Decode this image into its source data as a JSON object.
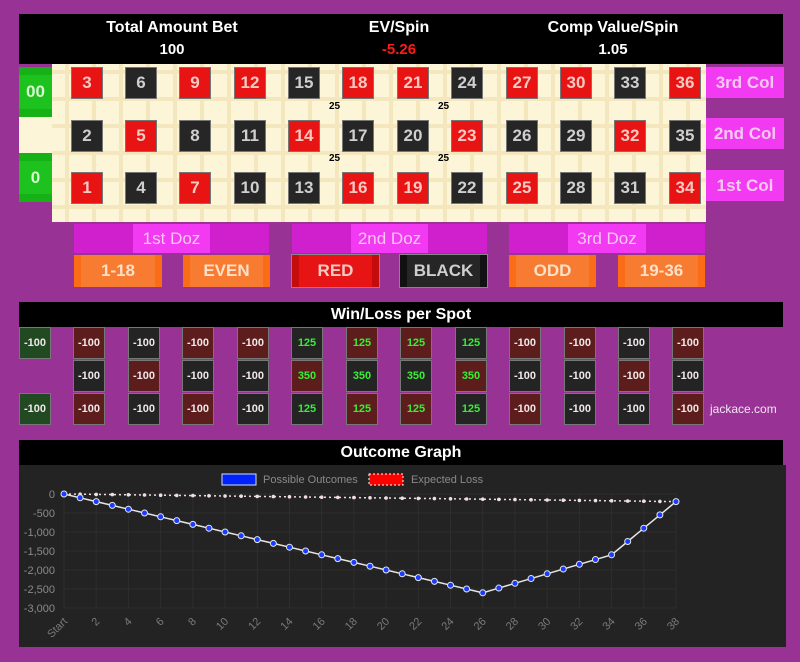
{
  "header": {
    "total_bet_label": "Total Amount Bet",
    "total_bet_value": "100",
    "ev_label": "EV/Spin",
    "ev_value": "-5.26",
    "comp_label": "Comp Value/Spin",
    "comp_value": "1.05"
  },
  "colors": {
    "ev_value": "#ff1a1a",
    "win": "#35f035",
    "background": "#983294"
  },
  "table": {
    "zero_top": "00",
    "zero_bottom": "0",
    "rows": [
      [
        {
          "n": "3",
          "c": "red"
        },
        {
          "n": "6",
          "c": "black"
        },
        {
          "n": "9",
          "c": "red"
        },
        {
          "n": "12",
          "c": "red"
        },
        {
          "n": "15",
          "c": "black"
        },
        {
          "n": "18",
          "c": "red"
        },
        {
          "n": "21",
          "c": "red"
        },
        {
          "n": "24",
          "c": "black"
        },
        {
          "n": "27",
          "c": "red"
        },
        {
          "n": "30",
          "c": "red"
        },
        {
          "n": "33",
          "c": "black"
        },
        {
          "n": "36",
          "c": "red"
        }
      ],
      [
        {
          "n": "2",
          "c": "black"
        },
        {
          "n": "5",
          "c": "red"
        },
        {
          "n": "8",
          "c": "black"
        },
        {
          "n": "11",
          "c": "black"
        },
        {
          "n": "14",
          "c": "red"
        },
        {
          "n": "17",
          "c": "black"
        },
        {
          "n": "20",
          "c": "black"
        },
        {
          "n": "23",
          "c": "red"
        },
        {
          "n": "26",
          "c": "black"
        },
        {
          "n": "29",
          "c": "black"
        },
        {
          "n": "32",
          "c": "red"
        },
        {
          "n": "35",
          "c": "black"
        }
      ],
      [
        {
          "n": "1",
          "c": "red"
        },
        {
          "n": "4",
          "c": "black"
        },
        {
          "n": "7",
          "c": "red"
        },
        {
          "n": "10",
          "c": "black"
        },
        {
          "n": "13",
          "c": "black"
        },
        {
          "n": "16",
          "c": "red"
        },
        {
          "n": "19",
          "c": "red"
        },
        {
          "n": "22",
          "c": "black"
        },
        {
          "n": "25",
          "c": "red"
        },
        {
          "n": "28",
          "c": "black"
        },
        {
          "n": "31",
          "c": "black"
        },
        {
          "n": "34",
          "c": "red"
        }
      ]
    ],
    "chips": [
      "25",
      "25",
      "25",
      "25"
    ],
    "columns": [
      "3rd Col",
      "2nd Col",
      "1st Col"
    ],
    "dozens": [
      "1st Doz",
      "2nd Doz",
      "3rd Doz"
    ],
    "even_bets": [
      "1-18",
      "EVEN",
      "RED",
      "BLACK",
      "ODD",
      "19-36"
    ]
  },
  "winloss": {
    "title": "Win/Loss per Spot",
    "zero_top": "-100",
    "zero_bottom": "-100",
    "rows": [
      [
        "-100",
        "-100",
        "-100",
        "-100",
        "125",
        "125",
        "125",
        "125",
        "-100",
        "-100",
        "-100",
        "-100"
      ],
      [
        "-100",
        "-100",
        "-100",
        "-100",
        "350",
        "350",
        "350",
        "350",
        "-100",
        "-100",
        "-100",
        "-100"
      ],
      [
        "-100",
        "-100",
        "-100",
        "-100",
        "125",
        "125",
        "125",
        "125",
        "-100",
        "-100",
        "-100",
        "-100"
      ]
    ],
    "credit": "jackace.com"
  },
  "graph": {
    "title": "Outcome Graph"
  },
  "chart_data": {
    "type": "line",
    "title": "Outcome Graph",
    "x": [
      "Start",
      "1",
      "2",
      "3",
      "4",
      "5",
      "6",
      "7",
      "8",
      "9",
      "10",
      "11",
      "12",
      "13",
      "14",
      "15",
      "16",
      "17",
      "18",
      "19",
      "20",
      "21",
      "22",
      "23",
      "24",
      "25",
      "26",
      "27",
      "28",
      "29",
      "30",
      "31",
      "32",
      "33",
      "34",
      "35",
      "36",
      "37",
      "38"
    ],
    "x_tick_labels": [
      "Start",
      "2",
      "4",
      "6",
      "8",
      "10",
      "12",
      "14",
      "16",
      "18",
      "20",
      "22",
      "24",
      "26",
      "28",
      "30",
      "32",
      "34",
      "36",
      "38"
    ],
    "series": [
      {
        "name": "Possible Outcomes",
        "color": "#0022ff",
        "values": [
          0,
          -100,
          -200,
          -300,
          -400,
          -500,
          -600,
          -700,
          -800,
          -900,
          -1000,
          -1100,
          -1200,
          -1300,
          -1400,
          -1500,
          -1600,
          -1700,
          -1800,
          -1900,
          -2000,
          -2100,
          -2200,
          -2300,
          -2400,
          -2500,
          -2600,
          -2475,
          -2350,
          -2225,
          -2100,
          -1975,
          -1850,
          -1725,
          -1600,
          -1250,
          -900,
          -550,
          -200
        ]
      },
      {
        "name": "Expected Loss",
        "color": "#ff0000",
        "values": [
          0,
          -5.26,
          -10.53,
          -15.79,
          -21.05,
          -26.32,
          -31.58,
          -36.84,
          -42.11,
          -47.37,
          -52.63,
          -57.89,
          -63.16,
          -68.42,
          -73.68,
          -78.95,
          -84.21,
          -89.47,
          -94.74,
          -100,
          -105.26,
          -110.53,
          -115.79,
          -121.05,
          -126.32,
          -131.58,
          -136.84,
          -142.11,
          -147.37,
          -152.63,
          -157.89,
          -163.16,
          -168.42,
          -173.68,
          -178.95,
          -184.21,
          -189.47,
          -194.74,
          -200
        ]
      }
    ],
    "y_ticks": [
      "0",
      "-500",
      "-1,000",
      "-1,500",
      "-2,000",
      "-2,500",
      "-3,000"
    ],
    "ylim": [
      -3000,
      0
    ],
    "legend": "top-center",
    "grid": true
  }
}
